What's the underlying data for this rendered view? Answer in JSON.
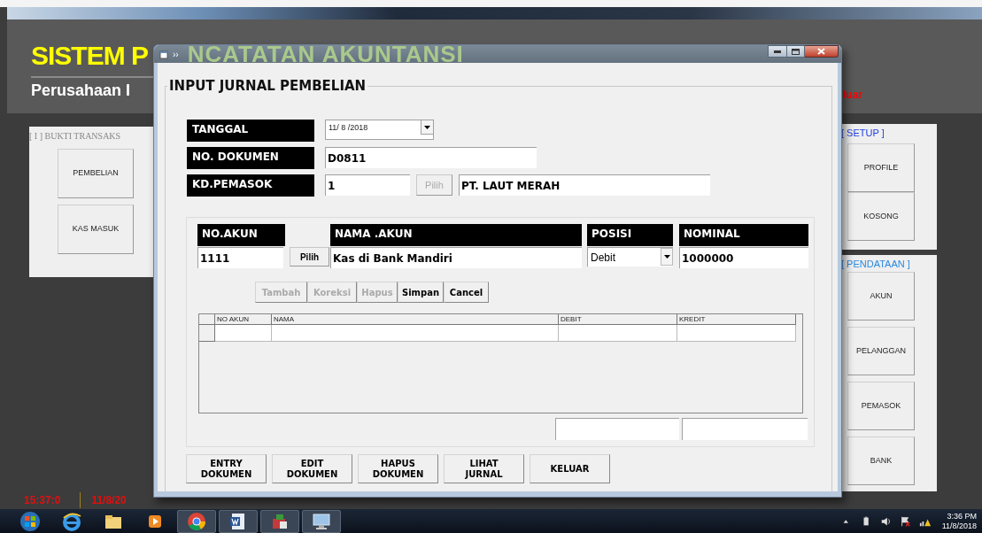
{
  "app": {
    "title": "SISTEM P",
    "subtitle": "Perusahaan I",
    "exit_link": "luar",
    "left_panel": {
      "title": "[ I ] BUKTI TRANSAKS",
      "buttons": [
        "PEMBELIAN",
        "KAS MASUK"
      ]
    },
    "setup_panel": {
      "title": "[ SETUP ]",
      "buttons": [
        "PROFILE",
        "KOSONG"
      ]
    },
    "data_panel": {
      "title": "[ PENDATAAN ]",
      "buttons": [
        "AKUN",
        "PELANGGAN",
        "PEMASOK",
        "BANK"
      ]
    },
    "clock": "15:37:0",
    "date": "11/8/20"
  },
  "dialog": {
    "title_text": "››",
    "glass_text": "NCATATAN AKUNTANSI",
    "group_title": "INPUT JURNAL PEMBELIAN",
    "header_fields": [
      {
        "kind": "date",
        "label": "TANGGAL",
        "value": "11/ 8 /2018"
      },
      {
        "kind": "text",
        "label": "NO. DOKUMEN",
        "value": "D0811"
      },
      {
        "kind": "lookup",
        "label": "KD.PEMASOK",
        "value": "1",
        "button": "Pilih",
        "button_disabled": true,
        "name_value": "PT. LAUT MERAH"
      }
    ],
    "entry": {
      "no_akun": {
        "label": "NO.AKUN",
        "value": "1111"
      },
      "pick_button": "Pilih",
      "nama_akun": {
        "label": "NAMA .AKUN",
        "value": "Kas di Bank Mandiri"
      },
      "posisi": {
        "label": "POSISI",
        "value": "Debit"
      },
      "nominal": {
        "label": "NOMINAL",
        "value": "1000000"
      }
    },
    "actions": [
      {
        "label": "Tambah",
        "disabled": true
      },
      {
        "label": "Koreksi",
        "disabled": true
      },
      {
        "label": "Hapus",
        "disabled": true
      },
      {
        "label": "Simpan",
        "disabled": false
      },
      {
        "label": "Cancel",
        "disabled": false
      }
    ],
    "grid": {
      "columns": [
        "NO AKUN",
        "NAMA",
        "DEBIT",
        "KREDIT"
      ]
    },
    "bottom_buttons": [
      "ENTRY DOKUMEN",
      "EDIT DOKUMEN",
      "HAPUS DOKUMEN",
      "LIHAT JURNAL",
      "KELUAR"
    ]
  },
  "taskbar": {
    "time": "3:36 PM",
    "date": "11/8/2018"
  }
}
